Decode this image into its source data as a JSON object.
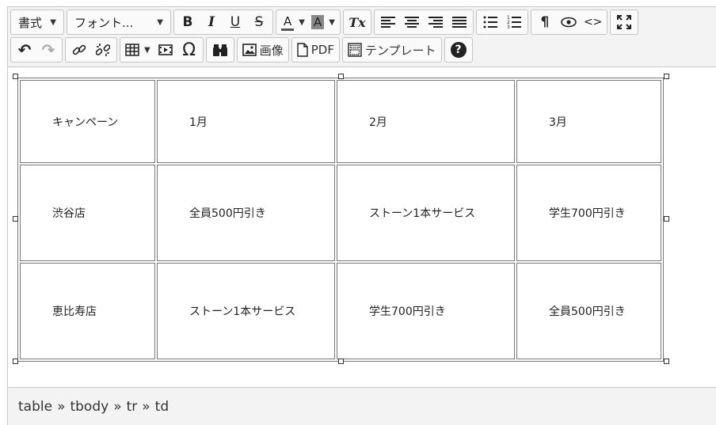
{
  "toolbar": {
    "format_label": "書式",
    "font_label": "フォント...",
    "bold": "B",
    "italic": "I",
    "underline": "U",
    "strike": "S",
    "font_color": "A",
    "bg_color": "A",
    "clear_format": "Tx",
    "pilcrow": "¶",
    "code": "<>",
    "undo": "↶",
    "redo": "↷",
    "omega": "Ω",
    "image_label": "画像",
    "pdf_label": "PDF",
    "template_label": "テンプレート",
    "help": "?"
  },
  "table": {
    "rows": [
      [
        "キャンペーン",
        "1月",
        "2月",
        "3月"
      ],
      [
        "渋谷店",
        "全員500円引き",
        "ストーン1本サービス",
        "学生700円引き"
      ],
      [
        "恵比寿店",
        "ストーン1本サービス",
        "学生700円引き",
        "全員500円引き"
      ]
    ]
  },
  "statusbar": {
    "path": [
      "table",
      "»",
      "tbody",
      "»",
      "tr",
      "»",
      "td"
    ]
  }
}
